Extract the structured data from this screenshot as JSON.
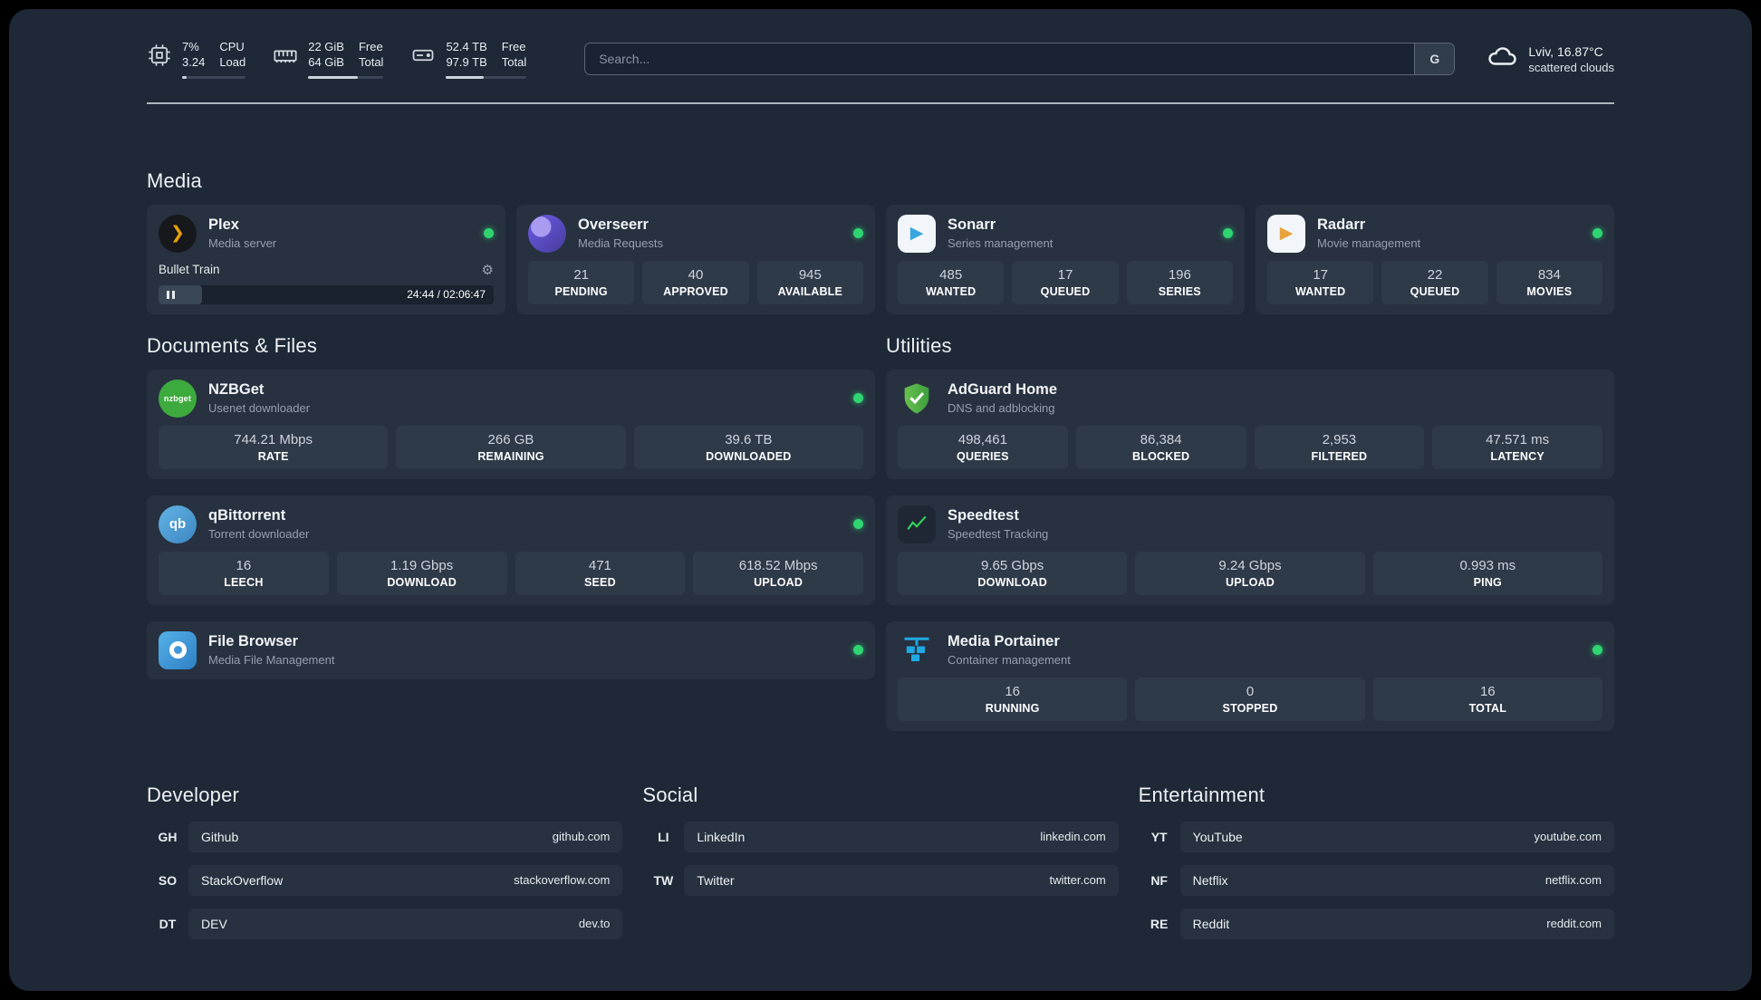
{
  "topbar": {
    "cpu": {
      "value_top": "7%",
      "value_bottom": "3.24",
      "label_top": "CPU",
      "label_bottom": "Load",
      "bar_percent": 7
    },
    "ram": {
      "value_top": "22 GiB",
      "value_bottom": "64 GiB",
      "label_top": "Free",
      "label_bottom": "Total",
      "bar_percent": 66
    },
    "disk": {
      "value_top": "52.4 TB",
      "value_bottom": "97.9 TB",
      "label_top": "Free",
      "label_bottom": "Total",
      "bar_percent": 47
    },
    "search": {
      "placeholder": "Search...",
      "button_label": "G"
    },
    "weather": {
      "location": "Lviv, 16.87°C",
      "condition": "scattered clouds"
    }
  },
  "sections": {
    "media": {
      "title": "Media"
    },
    "documents": {
      "title": "Documents & Files"
    },
    "utilities": {
      "title": "Utilities"
    },
    "developer": {
      "title": "Developer"
    },
    "social": {
      "title": "Social"
    },
    "entertainment": {
      "title": "Entertainment"
    }
  },
  "icons": {
    "gear": "⚙",
    "plex_chevron": "❯",
    "sonarr_play": "▶",
    "radarr_play": "▶"
  },
  "apps": {
    "plex": {
      "name": "Plex",
      "desc": "Media server",
      "track": "Bullet Train",
      "time": "24:44 / 02:06:47"
    },
    "overseerr": {
      "name": "Overseerr",
      "desc": "Media Requests",
      "stats": [
        {
          "value": "21",
          "label": "PENDING"
        },
        {
          "value": "40",
          "label": "APPROVED"
        },
        {
          "value": "945",
          "label": "AVAILABLE"
        }
      ]
    },
    "sonarr": {
      "name": "Sonarr",
      "desc": "Series management",
      "stats": [
        {
          "value": "485",
          "label": "WANTED"
        },
        {
          "value": "17",
          "label": "QUEUED"
        },
        {
          "value": "196",
          "label": "SERIES"
        }
      ]
    },
    "radarr": {
      "name": "Radarr",
      "desc": "Movie management",
      "stats": [
        {
          "value": "17",
          "label": "WANTED"
        },
        {
          "value": "22",
          "label": "QUEUED"
        },
        {
          "value": "834",
          "label": "MOVIES"
        }
      ]
    },
    "nzbget": {
      "name": "NZBGet",
      "desc": "Usenet downloader",
      "icon_text": "nzbget",
      "stats": [
        {
          "value": "744.21 Mbps",
          "label": "RATE"
        },
        {
          "value": "266 GB",
          "label": "REMAINING"
        },
        {
          "value": "39.6 TB",
          "label": "DOWNLOADED"
        }
      ]
    },
    "qbittorrent": {
      "name": "qBittorrent",
      "desc": "Torrent downloader",
      "icon_text": "qb",
      "stats": [
        {
          "value": "16",
          "label": "LEECH"
        },
        {
          "value": "1.19 Gbps",
          "label": "DOWNLOAD"
        },
        {
          "value": "471",
          "label": "SEED"
        },
        {
          "value": "618.52 Mbps",
          "label": "UPLOAD"
        }
      ]
    },
    "filebrowser": {
      "name": "File Browser",
      "desc": "Media File Management"
    },
    "adguard": {
      "name": "AdGuard Home",
      "desc": "DNS and adblocking",
      "stats": [
        {
          "value": "498,461",
          "label": "QUERIES"
        },
        {
          "value": "86,384",
          "label": "BLOCKED"
        },
        {
          "value": "2,953",
          "label": "FILTERED"
        },
        {
          "value": "47.571 ms",
          "label": "LATENCY"
        }
      ]
    },
    "speedtest": {
      "name": "Speedtest",
      "desc": "Speedtest Tracking",
      "stats": [
        {
          "value": "9.65 Gbps",
          "label": "DOWNLOAD"
        },
        {
          "value": "9.24 Gbps",
          "label": "UPLOAD"
        },
        {
          "value": "0.993 ms",
          "label": "PING"
        }
      ]
    },
    "portainer": {
      "name": "Media Portainer",
      "desc": "Container management",
      "stats": [
        {
          "value": "16",
          "label": "RUNNING"
        },
        {
          "value": "0",
          "label": "STOPPED"
        },
        {
          "value": "16",
          "label": "TOTAL"
        }
      ]
    }
  },
  "bookmarks": {
    "developer": [
      {
        "abbr": "GH",
        "name": "Github",
        "url": "github.com"
      },
      {
        "abbr": "SO",
        "name": "StackOverflow",
        "url": "stackoverflow.com"
      },
      {
        "abbr": "DT",
        "name": "DEV",
        "url": "dev.to"
      }
    ],
    "social": [
      {
        "abbr": "LI",
        "name": "LinkedIn",
        "url": "linkedin.com"
      },
      {
        "abbr": "TW",
        "name": "Twitter",
        "url": "twitter.com"
      }
    ],
    "entertainment": [
      {
        "abbr": "YT",
        "name": "YouTube",
        "url": "youtube.com"
      },
      {
        "abbr": "NF",
        "name": "Netflix",
        "url": "netflix.com"
      },
      {
        "abbr": "RE",
        "name": "Reddit",
        "url": "reddit.com"
      }
    ]
  },
  "colors": {
    "status_online": "#2fd571",
    "plex_amber": "#e5a00d",
    "sonarr_blue": "#36a6dd",
    "radarr_orange": "#e8a33b",
    "nzbget_green": "#3daa3d",
    "qbittorrent_blue": "#4f9fd8",
    "adguard_green": "#57b94c",
    "speedtest_green": "#30d158",
    "portainer_blue": "#1fa9e4"
  }
}
